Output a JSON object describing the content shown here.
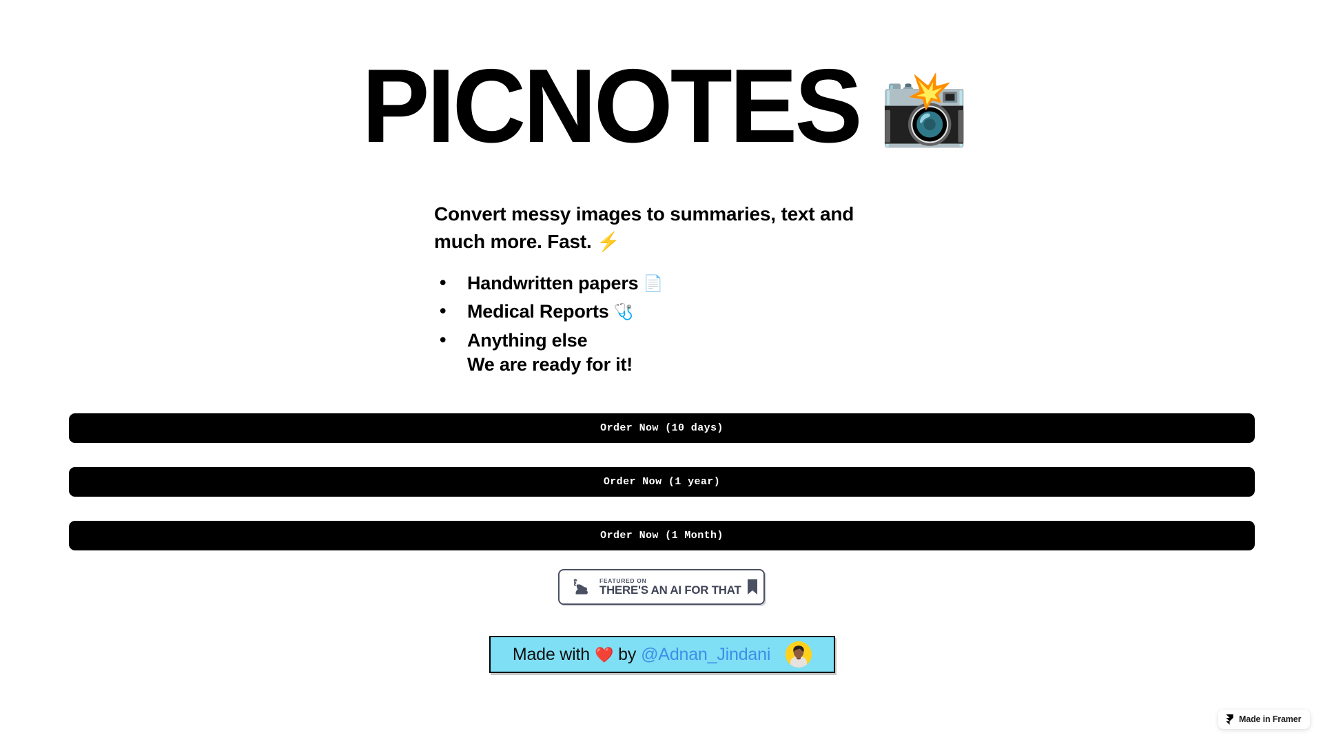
{
  "hero": {
    "title": "PICNOTES",
    "emoji": "📸",
    "emoji_name": "camera-with-flash-emoji"
  },
  "copy": {
    "lede": "Convert messy images to summaries, text and much more. Fast.",
    "lede_emoji": "⚡",
    "features": [
      {
        "label": "Handwritten papers",
        "emoji": "📄",
        "emoji_name": "page-facing-up-emoji",
        "sub": ""
      },
      {
        "label": "Medical Reports",
        "emoji": "🩺",
        "emoji_name": "stethoscope-emoji",
        "sub": ""
      },
      {
        "label": "Anything else",
        "emoji": "",
        "emoji_name": "",
        "sub": "We are ready for it!"
      }
    ]
  },
  "cta_buttons": [
    {
      "label": "Order Now (10 days)"
    },
    {
      "label": "Order Now (1 year)"
    },
    {
      "label": "Order Now (1 Month)"
    }
  ],
  "featured_badge": {
    "kicker": "FEATURED ON",
    "name": "THERE'S AN AI FOR THAT",
    "icon_name": "flexed-biceps-icon",
    "bookmark_icon_name": "bookmark-icon",
    "border_color": "#4b5063"
  },
  "made_with": {
    "prefix": "Made with",
    "heart": "❤️",
    "middle": "by",
    "handle": "@Adnan_Jindani",
    "background_color": "#7fdff5",
    "handle_color": "#3c8fe8",
    "avatar_background": "#ffd11a"
  },
  "framer_badge": {
    "label": "Made in Framer",
    "icon_name": "framer-logo-icon"
  }
}
